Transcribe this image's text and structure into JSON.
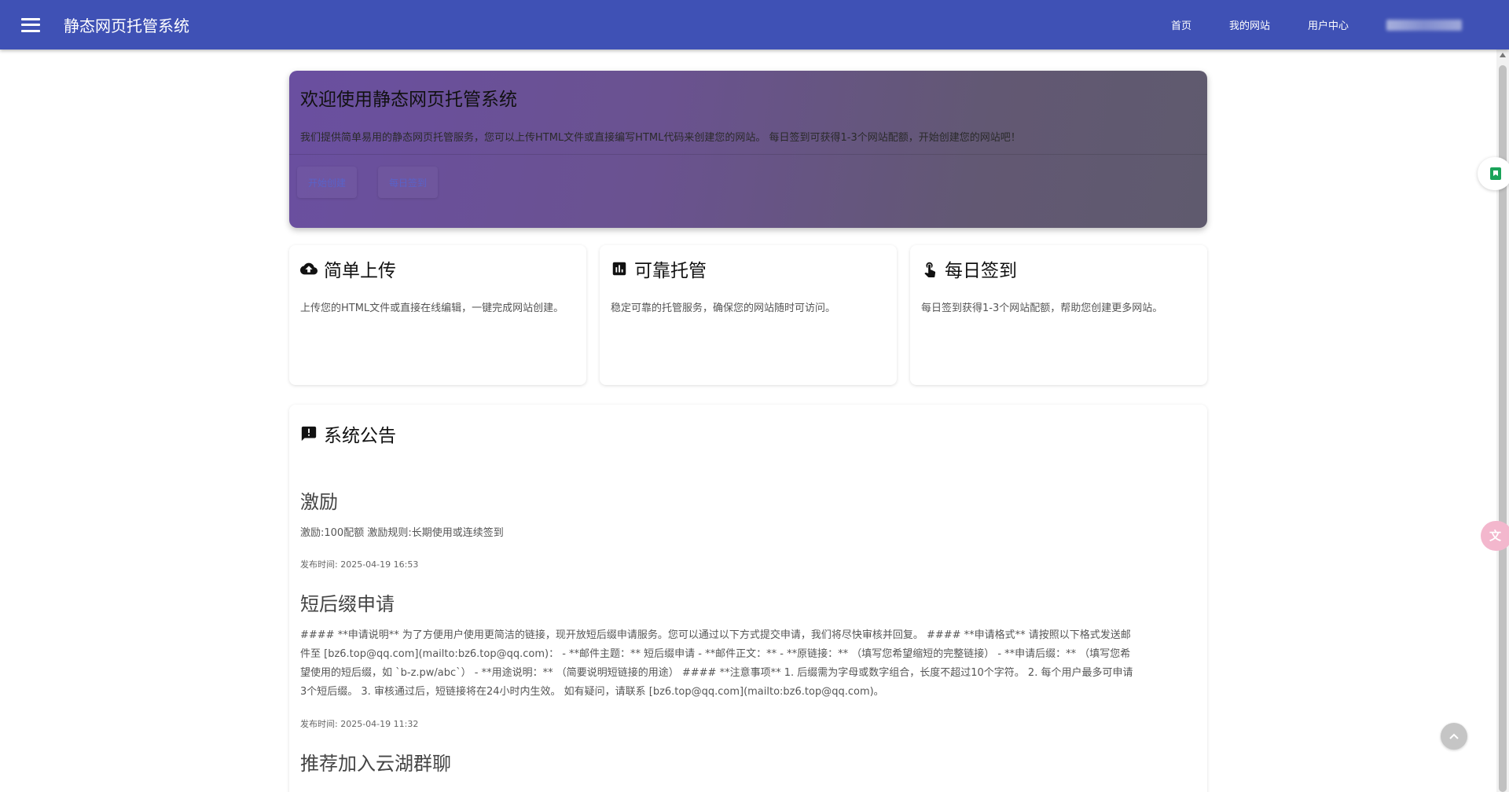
{
  "app": {
    "title": "静态网页托管系统"
  },
  "nav": {
    "items": [
      {
        "label": "首页"
      },
      {
        "label": "我的网站"
      },
      {
        "label": "用户中心"
      }
    ]
  },
  "hero": {
    "title": "欢迎使用静态网页托管系统",
    "description": "我们提供简单易用的静态网页托管服务，您可以上传HTML文件或直接编写HTML代码来创建您的网站。 每日签到可获得1-3个网站配额，开始创建您的网站吧！",
    "buttons": [
      {
        "label": "开始创建"
      },
      {
        "label": "每日签到"
      }
    ]
  },
  "features": [
    {
      "icon": "cloud-upload-icon",
      "title": "简单上传",
      "desc": "上传您的HTML文件或直接在线编辑，一键完成网站创建。"
    },
    {
      "icon": "chart-icon",
      "title": "可靠托管",
      "desc": "稳定可靠的托管服务，确保您的网站随时可访问。"
    },
    {
      "icon": "touch-icon",
      "title": "每日签到",
      "desc": "每日签到获得1-3个网站配额，帮助您创建更多网站。"
    }
  ],
  "notice": {
    "title": "系统公告",
    "posts": [
      {
        "title": "激励",
        "body": "激励:100配额 激励规则:长期使用或连续签到",
        "time": "发布时间: 2025-04-19 16:53"
      },
      {
        "title": "短后缀申请",
        "body": "#### **申请说明** 为了方便用户使用更简洁的链接，现开放短后缀申请服务。您可以通过以下方式提交申请，我们将尽快审核并回复。 #### **申请格式** 请按照以下格式发送邮件至 [bz6.top@qq.com](mailto:bz6.top@qq.com)： - **邮件主题：** 短后缀申请 - **邮件正文：** - **原链接：** （填写您希望缩短的完整链接） - **申请后缀：** （填写您希望使用的短后缀，如 `b-z.pw/abc`） - **用途说明：** （简要说明短链接的用途） #### **注意事项** 1. 后缀需为字母或数字组合，长度不超过10个字符。 2. 每个用户最多可申请3个短后缀。 3. 审核通过后，短链接将在24小时内生效。 如有疑问，请联系 [bz6.top@qq.com](mailto:bz6.top@qq.com)。",
        "time": "发布时间: 2025-04-19 11:32"
      },
      {
        "title": "推荐加入云湖群聊"
      }
    ]
  },
  "colors": {
    "appbar": "#3f51b5",
    "accent": "#5a62c8"
  }
}
